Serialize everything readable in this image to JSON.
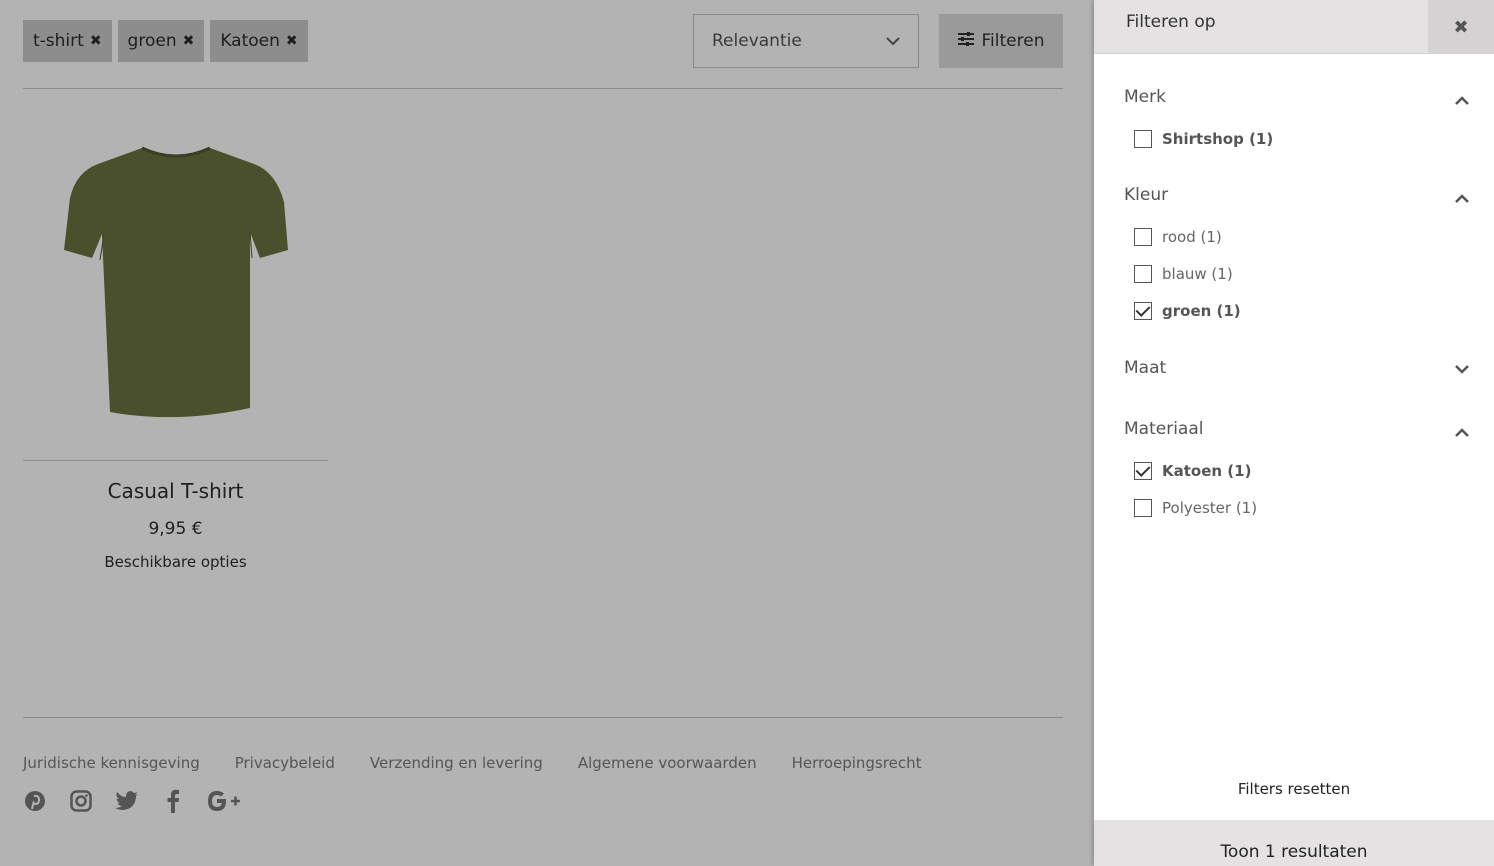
{
  "active_filters": [
    {
      "label": "t-shirt"
    },
    {
      "label": "groen"
    },
    {
      "label": "Katoen"
    }
  ],
  "sort": {
    "value": "Relevantie"
  },
  "filter_button": {
    "label": "Filteren"
  },
  "product": {
    "name": "Casual T-shirt",
    "price": "9,95 €",
    "options_label": "Beschikbare opties",
    "shirt_color": "#4a4f2c"
  },
  "footer": {
    "links": [
      "Juridische kennisgeving",
      "Privacybeleid",
      "Verzending en levering",
      "Algemene voorwaarden",
      "Herroepingsrecht"
    ],
    "social_icons": [
      "pinterest-icon",
      "instagram-icon",
      "twitter-icon",
      "facebook-icon",
      "google-plus-icon"
    ]
  },
  "panel": {
    "title": "Filteren op",
    "sections": [
      {
        "title": "Merk",
        "expanded": true,
        "options": [
          {
            "label": "Shirtshop (1)",
            "checked": false,
            "bold": true
          }
        ]
      },
      {
        "title": "Kleur",
        "expanded": true,
        "options": [
          {
            "label": "rood (1)",
            "checked": false,
            "bold": false
          },
          {
            "label": "blauw (1)",
            "checked": false,
            "bold": false
          },
          {
            "label": "groen (1)",
            "checked": true,
            "bold": true
          }
        ]
      },
      {
        "title": "Maat",
        "expanded": false,
        "options": []
      },
      {
        "title": "Materiaal",
        "expanded": true,
        "options": [
          {
            "label": "Katoen (1)",
            "checked": true,
            "bold": true
          },
          {
            "label": "Polyester (1)",
            "checked": false,
            "bold": false
          }
        ]
      }
    ],
    "reset_label": "Filters resetten",
    "results_label": "Toon 1 resultaten"
  }
}
